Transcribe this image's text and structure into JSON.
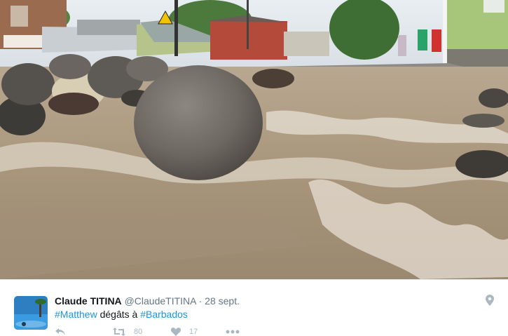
{
  "photo": {
    "description_icon": "flood-photo"
  },
  "tweet": {
    "display_name": "Claude TITINA",
    "handle": "@ClaudeTITINA",
    "separator": "·",
    "date": "28 sept.",
    "text": {
      "hashtag1": "#Matthew",
      "middle": " dégâts à ",
      "hashtag2": "#Barbados"
    },
    "location_icon": "location-pin-icon",
    "actions": {
      "reply_icon": "reply-icon",
      "retweet_icon": "retweet-icon",
      "retweet_count": "80",
      "like_icon": "heart-icon",
      "like_count": "17",
      "more_icon": "more-icon"
    }
  },
  "colors": {
    "hashtag": "#1b95e0",
    "muted": "#657786",
    "name": "#14171a"
  }
}
